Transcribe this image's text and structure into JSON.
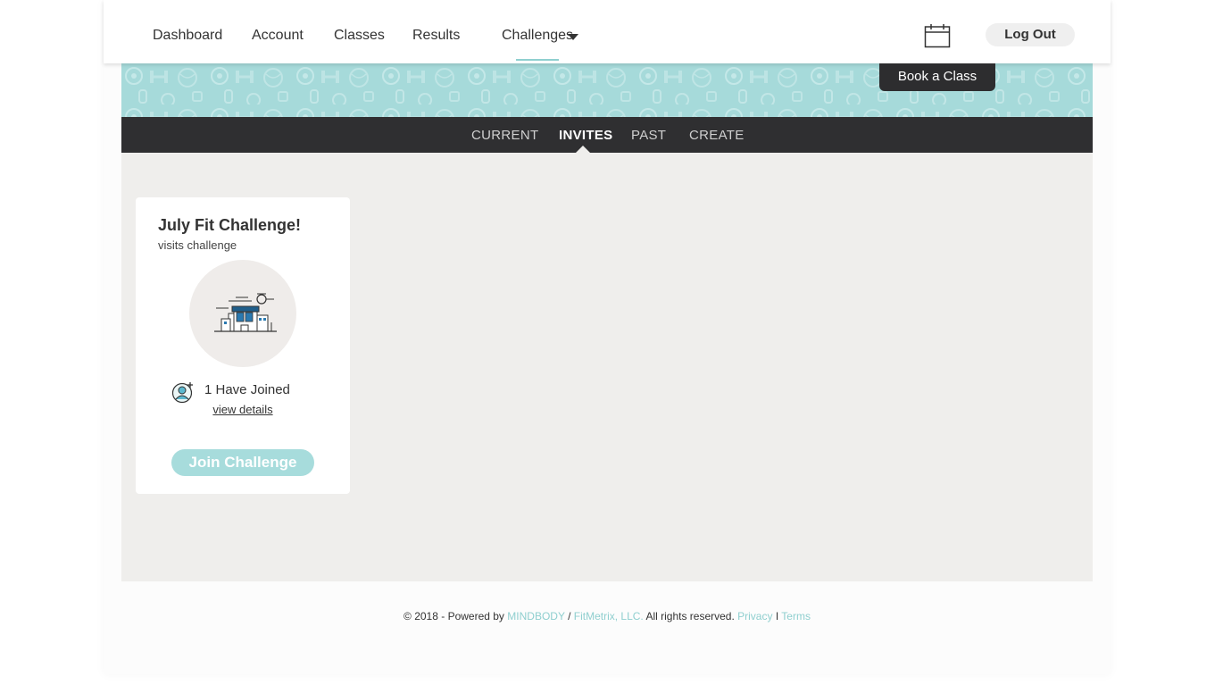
{
  "nav": {
    "items": [
      {
        "label": "Dashboard"
      },
      {
        "label": "Account"
      },
      {
        "label": "Classes"
      },
      {
        "label": "Results"
      },
      {
        "label": "Challenges"
      }
    ],
    "active": "Challenges",
    "logout_label": "Log Out",
    "calendar_icon": "calendar-icon",
    "dropdown_icon": "caret-down-icon"
  },
  "banner": {
    "book_label": "Book a Class",
    "pattern_color": "#a6dada"
  },
  "tabs": {
    "items": [
      {
        "label": "CURRENT"
      },
      {
        "label": "INVITES"
      },
      {
        "label": "PAST"
      },
      {
        "label": "CREATE"
      }
    ],
    "active": "INVITES"
  },
  "challenge_card": {
    "title": "July Fit Challenge!",
    "subtitle": "visits challenge",
    "illustration": "gym-building-icon",
    "joined_icon": "add-user-icon",
    "joined_text": "1 Have Joined",
    "view_details_label": "view details",
    "join_label": "Join Challenge"
  },
  "footer": {
    "prefix": "© 2018 - Powered by ",
    "mindbody": "MINDBODY",
    "slash": " / ",
    "fitmetrix": "FitMetrix, LLC.",
    "rights": " All rights reserved. ",
    "privacy": "Privacy",
    "separator": " I ",
    "terms": "Terms"
  },
  "colors": {
    "accent": "#8fd0d0",
    "banner": "#a6dada",
    "tabbar": "#2f2f31",
    "content_bg": "#efeeec",
    "join_button": "#a7dcdc"
  }
}
